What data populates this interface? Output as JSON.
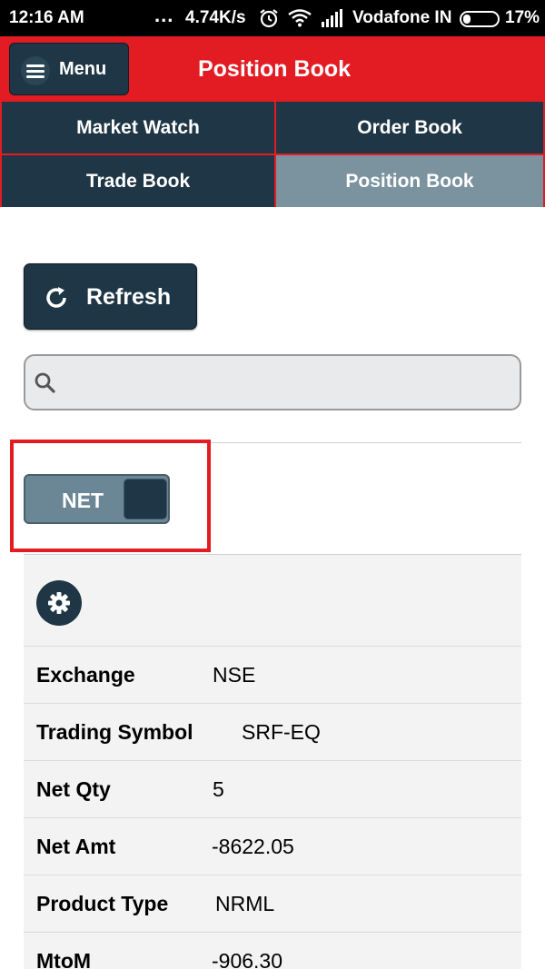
{
  "status_bar": {
    "time": "12:16 AM",
    "dots": "...",
    "speed": "4.74K/s",
    "carrier": "Vodafone IN",
    "battery": "17%",
    "icons": [
      "alarm-icon",
      "wifi-icon",
      "signal-icon",
      "battery-icon"
    ]
  },
  "header": {
    "menu_label": "Menu",
    "title": "Position Book",
    "accent_color": "#e31b23"
  },
  "nav": {
    "items": [
      {
        "label": "Market Watch",
        "active": false
      },
      {
        "label": "Order Book",
        "active": false
      },
      {
        "label": "Trade Book",
        "active": false
      },
      {
        "label": "Position Book",
        "active": true
      }
    ],
    "color": "#1e3645",
    "active_color": "#7a939f"
  },
  "refresh": {
    "label": "Refresh"
  },
  "search": {
    "placeholder": "",
    "value": ""
  },
  "toggle": {
    "label": "NET"
  },
  "position": {
    "rows": [
      {
        "key": "Exchange",
        "value": "NSE"
      },
      {
        "key": "Trading Symbol",
        "value": "SRF-EQ"
      },
      {
        "key": "Net Qty",
        "value": "5"
      },
      {
        "key": "Net Amt",
        "value": "-8622.05"
      },
      {
        "key": "Product Type",
        "value": "NRML"
      },
      {
        "key": "MtoM",
        "value": "-906.30"
      }
    ]
  }
}
